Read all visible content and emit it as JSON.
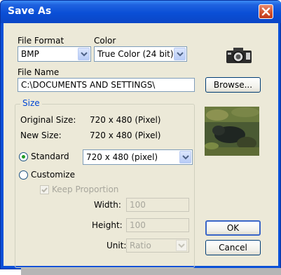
{
  "window": {
    "title": "Save As"
  },
  "format": {
    "label": "File Format",
    "value": "BMP"
  },
  "color": {
    "label": "Color",
    "value": "True Color (24 bit)"
  },
  "filename": {
    "label": "File Name",
    "value": "C:\\DOCUMENTS AND SETTINGS\\"
  },
  "browse_label": "Browse...",
  "size": {
    "legend": "Size",
    "original_label": "Original Size:",
    "original_value": "720 x 480 (Pixel)",
    "new_label": "New Size:",
    "new_value": "720 x 480 (Pixel)",
    "standard_label": "Standard",
    "standard_value": "720 x 480 (pixel)",
    "standard_selected": true,
    "customize_label": "Customize",
    "keep_label": "Keep Proportion",
    "keep_checked": true,
    "width_label": "Width:",
    "width_value": "100",
    "height_label": "Height:",
    "height_value": "100",
    "unit_label": "Unit:",
    "unit_value": "Ratio"
  },
  "ok_label": "OK",
  "cancel_label": "Cancel",
  "icons": {
    "camera": "camera-icon",
    "close": "close-icon",
    "preview": "preview-thumbnail"
  },
  "colors": {
    "title_bar": "#0a50d8",
    "dialog_bg": "#ece9d8",
    "group_title": "#0046d5"
  }
}
